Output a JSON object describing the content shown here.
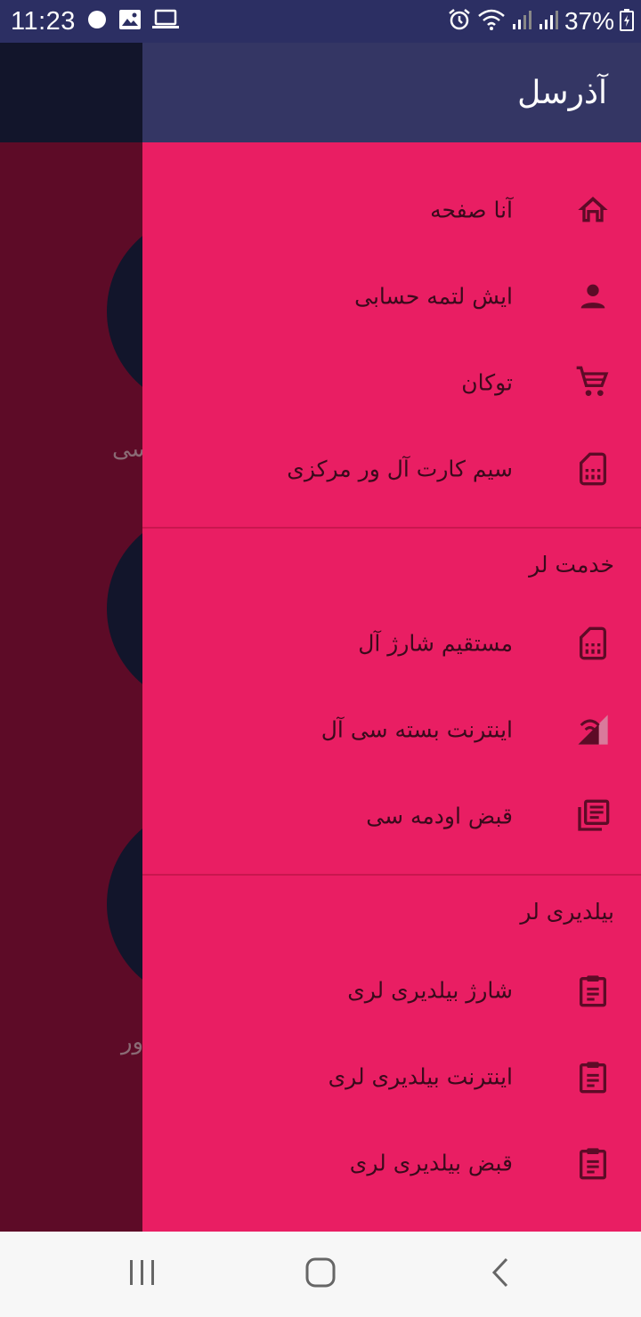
{
  "status_bar": {
    "time": "11:23",
    "battery": "37%"
  },
  "background": {
    "snippets": [
      "سی",
      "ور"
    ]
  },
  "drawer": {
    "title": "آذرسل",
    "main_items": [
      {
        "label": "آنا صفحه",
        "icon": "home-icon"
      },
      {
        "label": "ایش لتمه حسابی",
        "icon": "person-icon"
      },
      {
        "label": "توکان",
        "icon": "cart-icon"
      },
      {
        "label": "سیم کارت آل ور مرکزی",
        "icon": "sim-card-icon"
      }
    ],
    "services": {
      "header": "خدمت لر",
      "items": [
        {
          "label": "مستقیم شارژ آل",
          "icon": "sim-card-icon"
        },
        {
          "label": "اینترنت بسته سی آل",
          "icon": "signal-icon"
        },
        {
          "label": "قبض اودمه سی",
          "icon": "library-books-icon"
        }
      ]
    },
    "notifications": {
      "header": "بیلدیری لر",
      "items": [
        {
          "label": "شارژ بیلدیری لری",
          "icon": "clipboard-icon"
        },
        {
          "label": "اینترنت بیلدیری لری",
          "icon": "clipboard-icon"
        },
        {
          "label": "قبض بیلدیری لری",
          "icon": "clipboard-icon"
        }
      ]
    }
  },
  "colors": {
    "drawer_bg": "#e91e63",
    "header_bg": "#343664",
    "icon_color": "#5d0b27"
  }
}
